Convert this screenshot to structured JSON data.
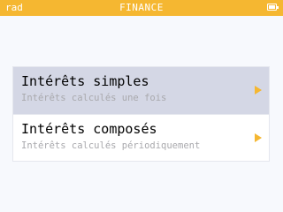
{
  "statusbar": {
    "mode": "rad",
    "title": "FINANCE",
    "battery_icon": "battery-icon",
    "color": "#f5b731"
  },
  "menu": {
    "items": [
      {
        "title": "Intérêts simples",
        "subtitle": "Intérêts calculés une fois",
        "selected": true,
        "arrow_icon": "chevron-right-icon"
      },
      {
        "title": "Intérêts composés",
        "subtitle": "Intérêts calculés périodiquement",
        "selected": false,
        "arrow_icon": "chevron-right-icon"
      }
    ]
  }
}
